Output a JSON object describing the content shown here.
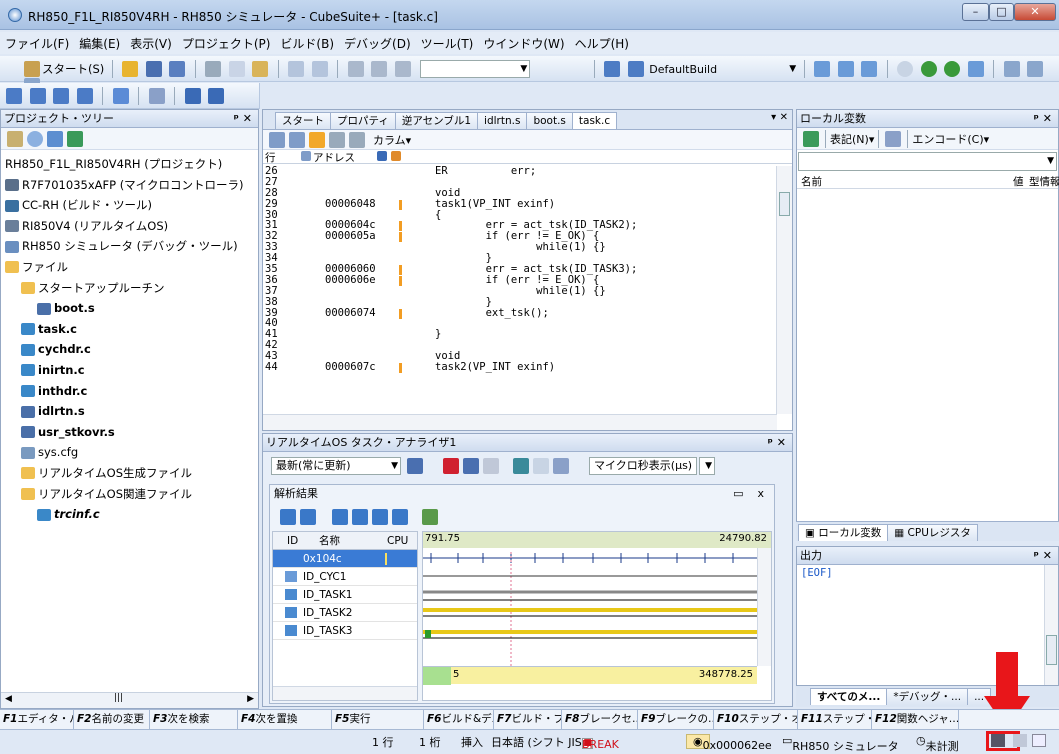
{
  "title": "RH850_F1L_RI850V4RH - RH850 シミュレータ - CubeSuite+ - [task.c]",
  "menu": [
    "ファイル(F)",
    "編集(E)",
    "表示(V)",
    "プロジェクト(P)",
    "ビルド(B)",
    "デバッグ(D)",
    "ツール(T)",
    "ウインドウ(W)",
    "ヘルプ(H)"
  ],
  "toolbar": {
    "start": "スタート(S)",
    "build_config": "DefaultBuild"
  },
  "project_tree": {
    "title": "プロジェクト・ツリー",
    "items": [
      {
        "label": "RH850_F1L_RI850V4RH (プロジェクト)",
        "indent": 0,
        "icon": "none",
        "bold": false
      },
      {
        "label": "R7F701035xAFP (マイクロコントローラ)",
        "indent": 0,
        "icon": "chip",
        "bold": false
      },
      {
        "label": "CC-RH (ビルド・ツール)",
        "indent": 0,
        "icon": "tool",
        "bold": false
      },
      {
        "label": "RI850V4 (リアルタイムOS)",
        "indent": 0,
        "icon": "os",
        "bold": false
      },
      {
        "label": "RH850 シミュレータ (デバッグ・ツール)",
        "indent": 0,
        "icon": "debug",
        "bold": false
      },
      {
        "label": "ファイル",
        "indent": 0,
        "icon": "folder",
        "bold": false
      },
      {
        "label": "スタートアップルーチン",
        "indent": 1,
        "icon": "folder",
        "bold": false
      },
      {
        "label": "boot.s",
        "indent": 2,
        "icon": "asm",
        "bold": true
      },
      {
        "label": "task.c",
        "indent": 1,
        "icon": "c",
        "bold": true
      },
      {
        "label": "cychdr.c",
        "indent": 1,
        "icon": "c",
        "bold": true
      },
      {
        "label": "inirtn.c",
        "indent": 1,
        "icon": "c",
        "bold": true
      },
      {
        "label": "inthdr.c",
        "indent": 1,
        "icon": "c",
        "bold": true
      },
      {
        "label": "idlrtn.s",
        "indent": 1,
        "icon": "asm",
        "bold": true
      },
      {
        "label": "usr_stkovr.s",
        "indent": 1,
        "icon": "asm",
        "bold": true
      },
      {
        "label": "sys.cfg",
        "indent": 1,
        "icon": "cfg",
        "bold": false
      },
      {
        "label": "リアルタイムOS生成ファイル",
        "indent": 1,
        "icon": "folder",
        "bold": false
      },
      {
        "label": "リアルタイムOS関連ファイル",
        "indent": 1,
        "icon": "folder",
        "bold": false
      },
      {
        "label": "trcinf.c",
        "indent": 2,
        "icon": "c",
        "bold": true
      }
    ]
  },
  "editor": {
    "tabs": [
      "スタート",
      "プロパティ",
      "逆アセンブル1",
      "idlrtn.s",
      "boot.s",
      "task.c"
    ],
    "column_label": "カラム",
    "header": {
      "line": "行",
      "address": "アドレス"
    },
    "lines": [
      {
        "n": "26",
        "addr": "",
        "bar": false,
        "src": "ER          err;"
      },
      {
        "n": "27",
        "addr": "",
        "bar": false,
        "src": ""
      },
      {
        "n": "28",
        "addr": "",
        "bar": false,
        "src": "void"
      },
      {
        "n": "29",
        "addr": "00006048",
        "bar": true,
        "src": "task1(VP_INT exinf)"
      },
      {
        "n": "30",
        "addr": "",
        "bar": false,
        "src": "{"
      },
      {
        "n": "31",
        "addr": "0000604c",
        "bar": true,
        "src": "        err = act_tsk(ID_TASK2);"
      },
      {
        "n": "32",
        "addr": "0000605a",
        "bar": true,
        "src": "        if (err != E_OK) {"
      },
      {
        "n": "33",
        "addr": "",
        "bar": false,
        "src": "                while(1) {}"
      },
      {
        "n": "34",
        "addr": "",
        "bar": false,
        "src": "        }"
      },
      {
        "n": "35",
        "addr": "00006060",
        "bar": true,
        "src": "        err = act_tsk(ID_TASK3);"
      },
      {
        "n": "36",
        "addr": "0000606e",
        "bar": true,
        "src": "        if (err != E_OK) {"
      },
      {
        "n": "37",
        "addr": "",
        "bar": false,
        "src": "                while(1) {}"
      },
      {
        "n": "38",
        "addr": "",
        "bar": false,
        "src": "        }"
      },
      {
        "n": "39",
        "addr": "00006074",
        "bar": true,
        "src": "        ext_tsk();"
      },
      {
        "n": "40",
        "addr": "",
        "bar": false,
        "src": ""
      },
      {
        "n": "41",
        "addr": "",
        "bar": false,
        "src": "}"
      },
      {
        "n": "42",
        "addr": "",
        "bar": false,
        "src": ""
      },
      {
        "n": "43",
        "addr": "",
        "bar": false,
        "src": "void"
      },
      {
        "n": "44",
        "addr": "0000607c",
        "bar": true,
        "src": "task2(VP_INT exinf)"
      }
    ]
  },
  "local_vars": {
    "title": "ローカル変数",
    "notation": "表記(N)",
    "encode": "エンコード(C)",
    "col_name": "名前",
    "col_value": "値",
    "col_type": "型情報"
  },
  "analyzer": {
    "title": "リアルタイムOS タスク・アナライザ1",
    "mode": "最新(常に更新)",
    "unit": "マイクロ秒表示(μs)",
    "result_label": "解析結果",
    "col_id": "ID",
    "col_name": "名称",
    "col_cpu": "CPU使",
    "time_start": "791.75",
    "time_end": "24790.82",
    "time_total": "348778.25",
    "time_bottom_start": "5",
    "rows": [
      "0x104c",
      "ID_CYC1",
      "ID_TASK1",
      "ID_TASK2",
      "ID_TASK3"
    ]
  },
  "right_tabs": [
    "ローカル変数",
    "CPUレジスタ"
  ],
  "output": {
    "title": "出力",
    "text": "[EOF]",
    "tabs": [
      "すべてのメ...",
      "*デバッグ・...",
      "..."
    ]
  },
  "fkeys": [
    {
      "key": "F1",
      "label": "エディタ・パ…"
    },
    {
      "key": "F2",
      "label": "名前の変更"
    },
    {
      "key": "F3",
      "label": "次を検索"
    },
    {
      "key": "F4",
      "label": "次を置換"
    },
    {
      "key": "F5",
      "label": "実行"
    },
    {
      "key": "F6",
      "label": "ビルド&デバ…"
    },
    {
      "key": "F7",
      "label": "ビルド・プロ…"
    },
    {
      "key": "F8",
      "label": "ブレークセ…"
    },
    {
      "key": "F9",
      "label": "ブレークの…"
    },
    {
      "key": "F10",
      "label": "ステップ・オ…"
    },
    {
      "key": "F11",
      "label": "ステップ・イン"
    },
    {
      "key": "F12",
      "label": "関数ヘジャ…"
    }
  ],
  "status": {
    "line": "1 行",
    "col": "1 桁",
    "mode": "挿入",
    "encoding": "日本語 (シフト JIS)",
    "state": "BREAK",
    "pc": "0x000062ee",
    "target": "RH850 シミュレータ",
    "timer": "未計測"
  },
  "colors": {
    "accent": "#1a58c8",
    "highlight": "#e8161a",
    "bar": "#f29d23",
    "selection": "#3a7bd5"
  }
}
